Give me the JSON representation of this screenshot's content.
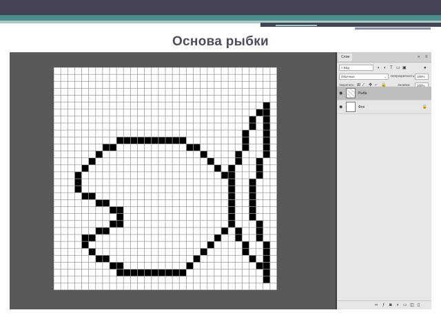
{
  "slide": {
    "title": "Основа рыбки"
  },
  "layers_panel": {
    "tab_label": "Слои",
    "menu_icons": [
      "collapse-icon",
      "panel-menu-icon"
    ],
    "filter": {
      "kind_value": "Вид"
    },
    "blend_mode": {
      "value": "Обычные",
      "opacity_label": "Непрозрачность:",
      "opacity_value": "100%"
    },
    "lock": {
      "label": "Закрепить:",
      "fill_label": "Заливка:",
      "fill_value": "100%"
    },
    "layers": [
      {
        "name": "Рыба",
        "selected": true,
        "visible": true,
        "locked": false
      },
      {
        "name": "Фон",
        "selected": false,
        "visible": true,
        "locked": true
      }
    ],
    "footer_icons": [
      "link-icon",
      "fx-icon",
      "mask-icon",
      "adjustment-icon",
      "folder-icon",
      "new-layer-icon",
      "trash-icon"
    ]
  },
  "canvas": {
    "grid_columns": 32,
    "grid_rows": 32,
    "filled_cells": [
      [
        30,
        5
      ],
      [
        29,
        6
      ],
      [
        30,
        6
      ],
      [
        28,
        7
      ],
      [
        30,
        7
      ],
      [
        28,
        8
      ],
      [
        30,
        8
      ],
      [
        27,
        9
      ],
      [
        30,
        9
      ],
      [
        9,
        10
      ],
      [
        10,
        10
      ],
      [
        11,
        10
      ],
      [
        12,
        10
      ],
      [
        13,
        10
      ],
      [
        14,
        10
      ],
      [
        15,
        10
      ],
      [
        16,
        10
      ],
      [
        17,
        10
      ],
      [
        18,
        10
      ],
      [
        27,
        10
      ],
      [
        30,
        10
      ],
      [
        7,
        11
      ],
      [
        8,
        11
      ],
      [
        19,
        11
      ],
      [
        20,
        11
      ],
      [
        27,
        11
      ],
      [
        30,
        11
      ],
      [
        6,
        12
      ],
      [
        21,
        12
      ],
      [
        26,
        12
      ],
      [
        30,
        12
      ],
      [
        5,
        13
      ],
      [
        22,
        13
      ],
      [
        26,
        13
      ],
      [
        29,
        13
      ],
      [
        4,
        14
      ],
      [
        23,
        14
      ],
      [
        25,
        14
      ],
      [
        29,
        14
      ],
      [
        3,
        15
      ],
      [
        24,
        15
      ],
      [
        25,
        15
      ],
      [
        29,
        15
      ],
      [
        3,
        16
      ],
      [
        25,
        16
      ],
      [
        28,
        16
      ],
      [
        3,
        17
      ],
      [
        25,
        17
      ],
      [
        28,
        17
      ],
      [
        4,
        18
      ],
      [
        5,
        18
      ],
      [
        25,
        18
      ],
      [
        28,
        18
      ],
      [
        6,
        19
      ],
      [
        7,
        19
      ],
      [
        25,
        19
      ],
      [
        28,
        19
      ],
      [
        8,
        20
      ],
      [
        9,
        20
      ],
      [
        25,
        20
      ],
      [
        28,
        20
      ],
      [
        9,
        21
      ],
      [
        25,
        21
      ],
      [
        28,
        21
      ],
      [
        8,
        22
      ],
      [
        9,
        22
      ],
      [
        25,
        22
      ],
      [
        29,
        22
      ],
      [
        6,
        23
      ],
      [
        7,
        23
      ],
      [
        24,
        23
      ],
      [
        26,
        23
      ],
      [
        29,
        23
      ],
      [
        4,
        24
      ],
      [
        5,
        24
      ],
      [
        23,
        24
      ],
      [
        26,
        24
      ],
      [
        29,
        24
      ],
      [
        4,
        25
      ],
      [
        22,
        25
      ],
      [
        27,
        25
      ],
      [
        30,
        25
      ],
      [
        5,
        26
      ],
      [
        21,
        26
      ],
      [
        27,
        26
      ],
      [
        30,
        26
      ],
      [
        6,
        27
      ],
      [
        7,
        27
      ],
      [
        20,
        27
      ],
      [
        28,
        27
      ],
      [
        30,
        27
      ],
      [
        8,
        28
      ],
      [
        9,
        28
      ],
      [
        19,
        28
      ],
      [
        29,
        28
      ],
      [
        30,
        28
      ],
      [
        9,
        29
      ],
      [
        10,
        29
      ],
      [
        11,
        29
      ],
      [
        12,
        29
      ],
      [
        13,
        29
      ],
      [
        14,
        29
      ],
      [
        15,
        29
      ],
      [
        16,
        29
      ],
      [
        17,
        29
      ],
      [
        18,
        29
      ],
      [
        30,
        29
      ],
      [
        30,
        30
      ]
    ]
  }
}
